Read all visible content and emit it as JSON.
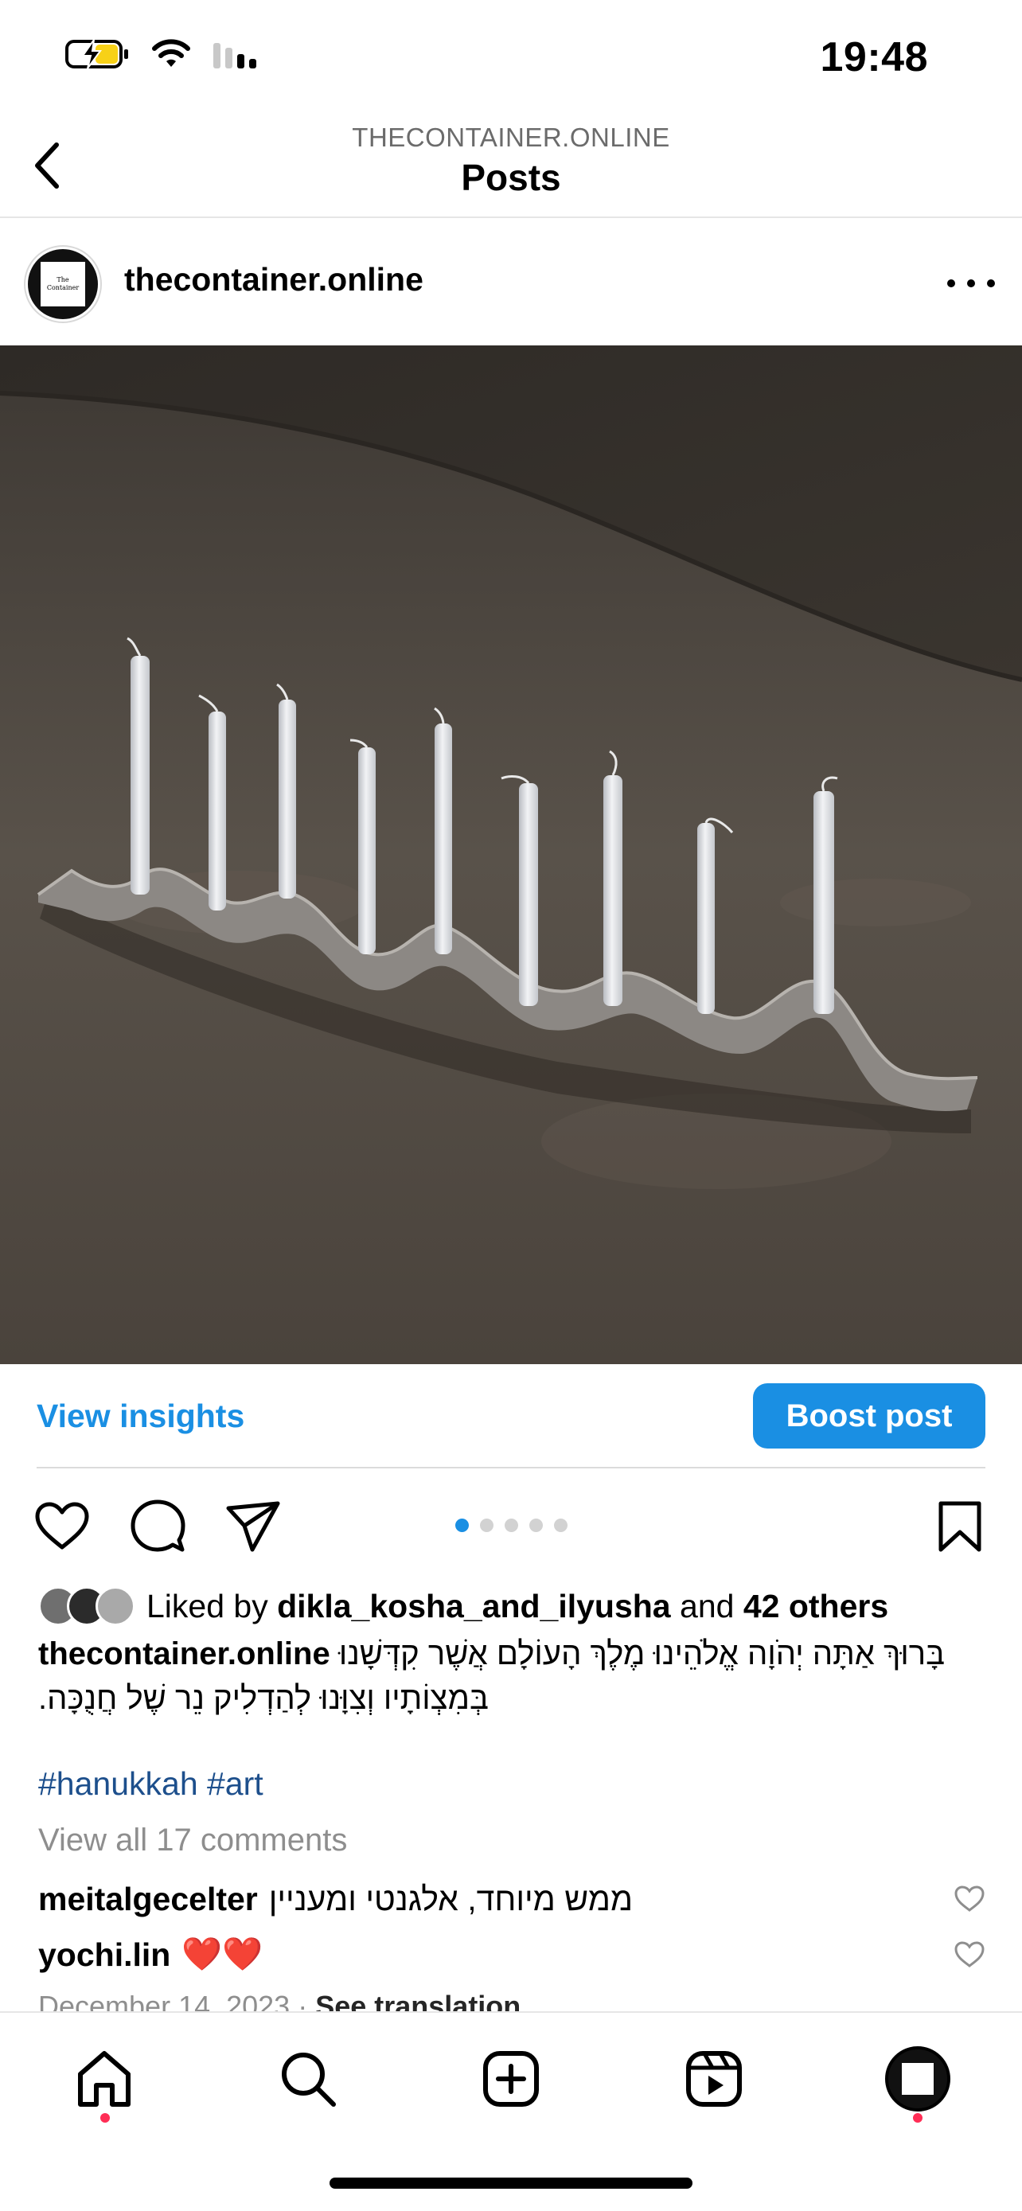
{
  "status_bar": {
    "time": "19:48"
  },
  "header": {
    "subtitle": "THECONTAINER.ONLINE",
    "title": "Posts"
  },
  "post": {
    "username": "thecontainer.online",
    "avatar_text": "The Container",
    "carousel": {
      "count": 5,
      "active": 1
    }
  },
  "insights": {
    "view_insights": "View insights",
    "boost_post": "Boost post"
  },
  "likes": {
    "prefix": "Liked by ",
    "user": "dikla_kosha_and_ilyusha",
    "middle": " and ",
    "others": "42 others"
  },
  "caption": {
    "user": "thecontainer.online",
    "text": "בָּרוּךְ אַתָּה יְהֹוָה אֱלֹהֵינוּ מֶלֶךְ הָעוֹלָם אֲשֶׁר קִדְּשָׁנוּ בְּמִצְוֹתָיו וְצִוָּנוּ לְהַדְלִיק נֵר שֶׁל חֲנֻכָּה."
  },
  "hashtags": "#hanukkah #art",
  "view_comments": "View all 17 comments",
  "comments": [
    {
      "user": "meitalgecelter",
      "text": "ממש מיוחד, אלגנטי ומעניין"
    },
    {
      "user": "yochi.lin",
      "text": "❤️❤️"
    }
  ],
  "date": "December 14, 2023",
  "date_separator": " · ",
  "see_translation": "See translation",
  "colors": {
    "accent": "#1a8fe3",
    "notification": "#ff2d55",
    "hashtag": "#1d4f8c"
  }
}
